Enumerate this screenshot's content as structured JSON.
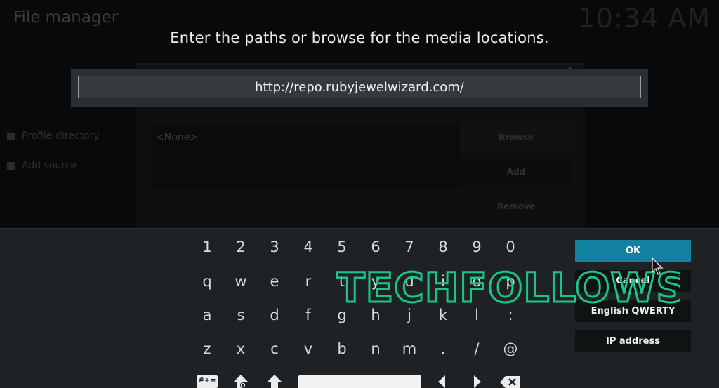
{
  "background": {
    "title": "File manager",
    "clock": "10:34 AM",
    "side_items": [
      "Profile directory",
      "Add source"
    ],
    "none_entry": "<None>",
    "buttons": [
      "Browse",
      "Add",
      "Remove"
    ]
  },
  "dialog": {
    "heading": "Enter the paths or browse for the media locations.",
    "url_value": "http://repo.rubyjewelwizard.com/"
  },
  "keyboard": {
    "rows": [
      [
        "1",
        "2",
        "3",
        "4",
        "5",
        "6",
        "7",
        "8",
        "9",
        "0"
      ],
      [
        "q",
        "w",
        "e",
        "r",
        "t",
        "y",
        "u",
        "i",
        "o",
        "p"
      ],
      [
        "a",
        "s",
        "d",
        "f",
        "g",
        "h",
        "j",
        "k",
        "l",
        ":"
      ],
      [
        "z",
        "x",
        "c",
        "v",
        "b",
        "n",
        "m",
        ".",
        "/",
        "@"
      ]
    ],
    "symbols_label": "#+=",
    "side_buttons": {
      "ok": "OK",
      "cancel": "Cancel",
      "layout": "English QWERTY",
      "ip": "IP address"
    }
  },
  "watermark": "TECHFOLLOWS",
  "colors": {
    "accent": "#12809f",
    "panel": "#1e2225",
    "watermark": "#1ec38a"
  },
  "icons": [
    "up-arrow-icon",
    "shift-icon",
    "caps-lock-icon",
    "left-arrow-icon",
    "right-arrow-icon",
    "backspace-icon",
    "mouse-cursor-icon"
  ]
}
